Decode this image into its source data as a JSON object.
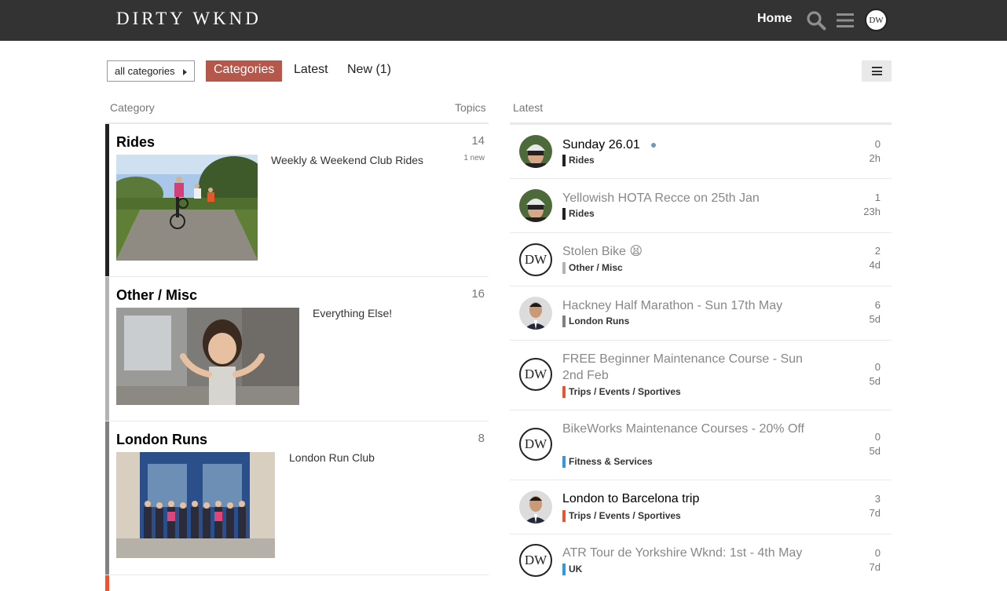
{
  "header": {
    "logo_text": "DIRTY WKND",
    "home_label": "Home",
    "user_initials": "DW"
  },
  "nav": {
    "dropdown_label": "all categories",
    "tabs": [
      {
        "label": "Categories",
        "active": true
      },
      {
        "label": "Latest",
        "active": false
      },
      {
        "label": "New (1)",
        "active": false
      }
    ]
  },
  "columns": {
    "category": "Category",
    "topics": "Topics",
    "latest": "Latest"
  },
  "categories": [
    {
      "name": "Rides",
      "description": "Weekly & Weekend Club Rides",
      "topics": "14",
      "new": "1 new",
      "color": "#222222"
    },
    {
      "name": "Other / Misc",
      "description": "Everything Else!",
      "topics": "16",
      "new": "",
      "color": "#b3b3b3"
    },
    {
      "name": "London Runs",
      "description": "London Run Club",
      "topics": "8",
      "new": "",
      "color": "#808080"
    }
  ],
  "topics": [
    {
      "title": "Sunday 26.01",
      "category": "Rides",
      "cat_color": "#222222",
      "replies": "0",
      "age": "2h",
      "avatar": "cyclist",
      "unread": true,
      "new_dot": true
    },
    {
      "title": "Yellowish HOTA Recce on 25th Jan",
      "category": "Rides",
      "cat_color": "#222222",
      "replies": "1",
      "age": "23h",
      "avatar": "cyclist",
      "unread": false
    },
    {
      "title": "Stolen Bike 😫",
      "category": "Other / Misc",
      "cat_color": "#b3b3b3",
      "replies": "2",
      "age": "4d",
      "avatar": "DW",
      "unread": false
    },
    {
      "title": "Hackney Half Marathon - Sun 17th May",
      "category": "London Runs",
      "cat_color": "#808080",
      "replies": "6",
      "age": "5d",
      "avatar": "man",
      "unread": false
    },
    {
      "title": "FREE Beginner Maintenance Course - Sun 2nd Feb",
      "category": "Trips / Events / Sportives",
      "cat_color": "#e45735",
      "replies": "0",
      "age": "5d",
      "avatar": "DW",
      "unread": false
    },
    {
      "title": "BikeWorks Maintenance Courses - 20% Off",
      "category": "Fitness & Services",
      "cat_color": "#3498db",
      "replies": "0",
      "age": "5d",
      "avatar": "DW",
      "unread": false
    },
    {
      "title": "London to Barcelona trip",
      "category": "Trips / Events / Sportives",
      "cat_color": "#e45735",
      "replies": "3",
      "age": "7d",
      "avatar": "man",
      "unread": true
    },
    {
      "title": "ATR Tour de Yorkshire Wknd: 1st - 4th May",
      "category": "UK",
      "cat_color": "#3498db",
      "replies": "0",
      "age": "7d",
      "avatar": "DW",
      "unread": false
    }
  ]
}
